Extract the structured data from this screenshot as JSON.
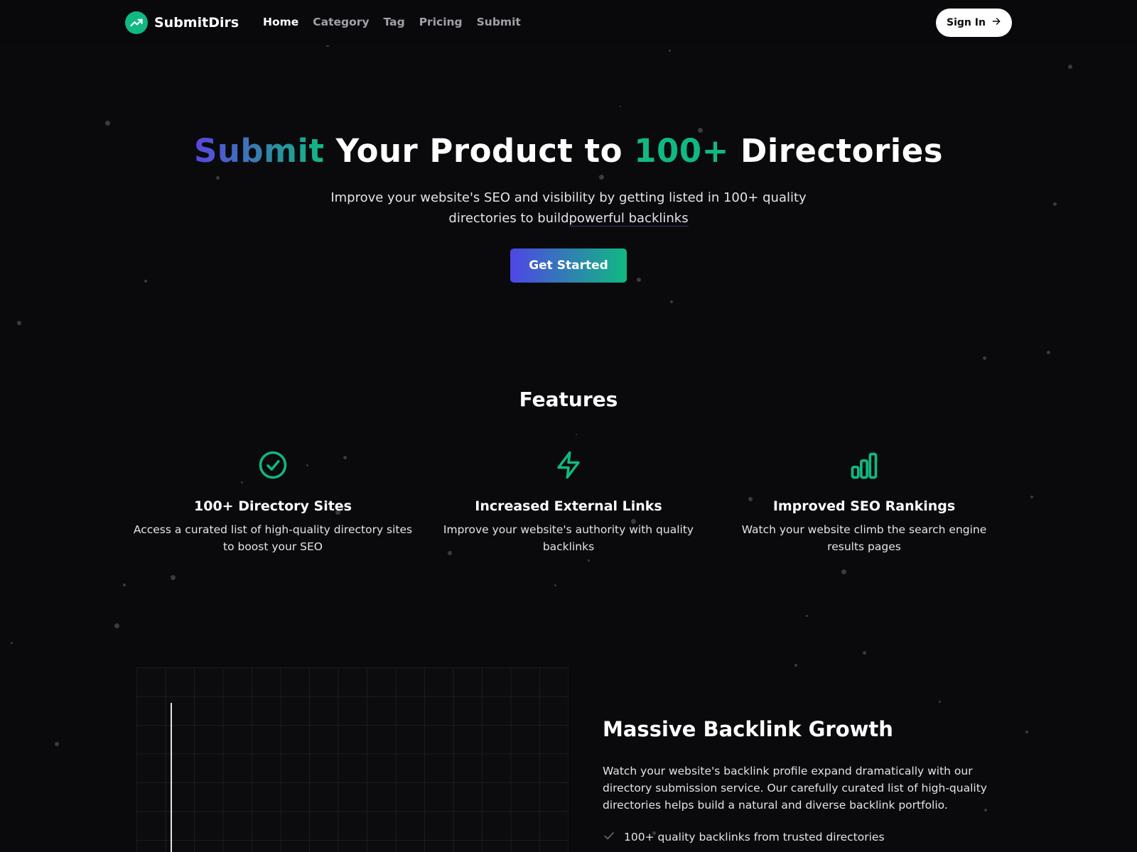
{
  "brand": {
    "name": "SubmitDirs"
  },
  "nav": {
    "items": [
      {
        "label": "Home",
        "active": true
      },
      {
        "label": "Category",
        "active": false
      },
      {
        "label": "Tag",
        "active": false
      },
      {
        "label": "Pricing",
        "active": false
      },
      {
        "label": "Submit",
        "active": false
      }
    ],
    "signin_label": "Sign In"
  },
  "hero": {
    "title_word1": "Submit",
    "title_part2": " Your Product to ",
    "title_highlight": "100+",
    "title_part3": " Directories",
    "subtitle_part1": "Improve your website's SEO and visibility by getting listed in 100+ quality directories to build",
    "subtitle_underlined": "powerful backlinks",
    "cta_label": "Get Started"
  },
  "features": {
    "title": "Features",
    "items": [
      {
        "icon": "check-circle-icon",
        "title": "100+ Directory Sites",
        "desc": "Access a curated list of high-quality directory sites to boost your SEO"
      },
      {
        "icon": "lightning-icon",
        "title": "Increased External Links",
        "desc": "Improve your website's authority with quality backlinks"
      },
      {
        "icon": "bar-chart-icon",
        "title": "Improved SEO Rankings",
        "desc": "Watch your website climb the search engine results pages"
      }
    ]
  },
  "growth": {
    "title": "Massive Backlink Growth",
    "description": "Watch your website's backlink profile expand dramatically with our directory submission service. Our carefully curated list of high-quality directories helps build a natural and diverse backlink portfolio.",
    "bullets": [
      "100+ quality backlinks from trusted directories"
    ]
  },
  "colors": {
    "accent_green": "#10b981",
    "accent_indigo": "#4f46e5",
    "background": "#0a0a0c"
  }
}
